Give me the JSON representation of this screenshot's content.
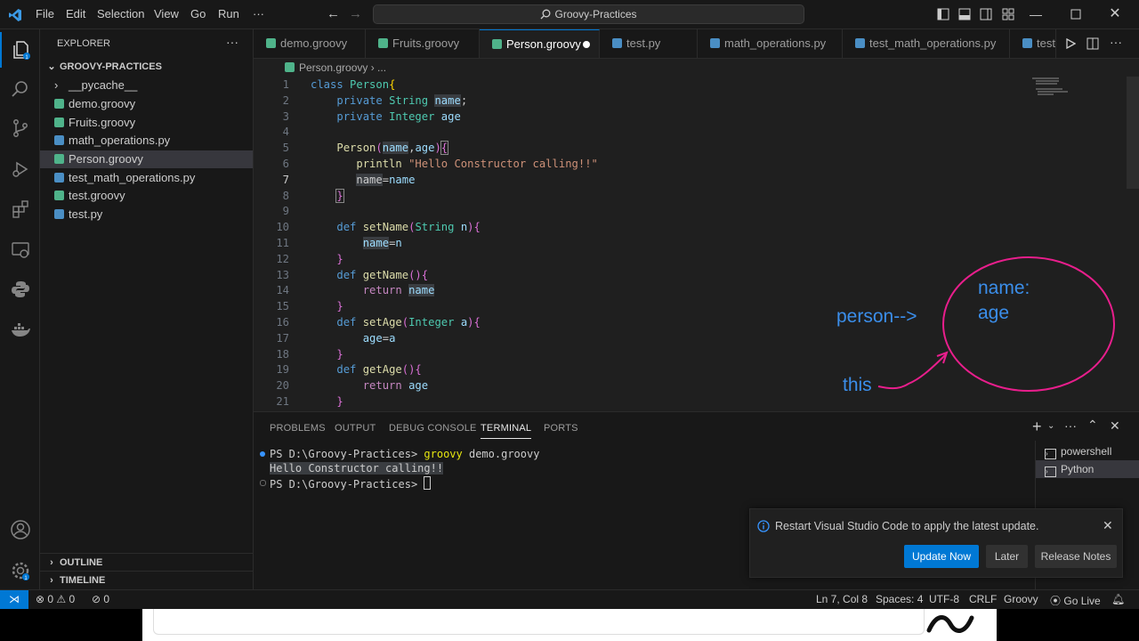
{
  "titlebar": {
    "menu": [
      "File",
      "Edit",
      "Selection",
      "View",
      "Go",
      "Run",
      "···"
    ],
    "search": "Groovy-Practices"
  },
  "sidebar": {
    "title": "EXPLORER",
    "more": "···",
    "folder": "GROOVY-PRACTICES",
    "items": [
      {
        "label": "__pycache__",
        "type": "folder"
      },
      {
        "label": "demo.groovy",
        "type": "groovy"
      },
      {
        "label": "Fruits.groovy",
        "type": "groovy"
      },
      {
        "label": "math_operations.py",
        "type": "python"
      },
      {
        "label": "Person.groovy",
        "type": "groovy"
      },
      {
        "label": "test_math_operations.py",
        "type": "python"
      },
      {
        "label": "test.groovy",
        "type": "groovy"
      },
      {
        "label": "test.py",
        "type": "python"
      }
    ],
    "outline": "OUTLINE",
    "timeline": "TIMELINE"
  },
  "tabs": [
    "demo.groovy",
    "Fruits.groovy",
    "Person.groovy",
    "test.py",
    "math_operations.py",
    "test_math_operations.py",
    "test.py"
  ],
  "editor": {
    "breadcrumb_file": "Person.groovy",
    "breadcrumb_rest": "...",
    "line_numbers": [
      "1",
      "2",
      "3",
      "4",
      "5",
      "6",
      "7",
      "8",
      "9",
      "10",
      "11",
      "12",
      "13",
      "14",
      "15",
      "16",
      "17",
      "18",
      "19",
      "20",
      "21"
    ]
  },
  "annotation": {
    "person": "person-->",
    "name": "name:",
    "age": "age",
    "this": "this"
  },
  "panel": {
    "tabs": [
      "PROBLEMS",
      "OUTPUT",
      "DEBUG CONSOLE",
      "TERMINAL",
      "PORTS"
    ],
    "active_tab": "TERMINAL",
    "terminal_lines": [
      {
        "prompt": "PS D:\\Groovy-Practices> ",
        "cmd": "groovy",
        "args": " demo.groovy"
      },
      {
        "output": "Hello Constructor calling!!"
      },
      {
        "prompt": "PS D:\\Groovy-Practices> "
      }
    ],
    "terminals": [
      "powershell",
      "Python"
    ]
  },
  "notification": {
    "message": "Restart Visual Studio Code to apply the latest update.",
    "buttons": [
      "Update Now",
      "Later",
      "Release Notes"
    ]
  },
  "status": {
    "errors": "0",
    "warnings": "0",
    "ports": "0",
    "position": "Ln 7, Col 8",
    "spaces": "Spaces: 4",
    "encoding": "UTF-8",
    "eol": "CRLF",
    "language": "Groovy",
    "golive": "Go Live"
  },
  "colors": {
    "accent": "#0078d4",
    "annotation_blue": "#3b8eea",
    "annotation_pink": "#e81e8c"
  }
}
